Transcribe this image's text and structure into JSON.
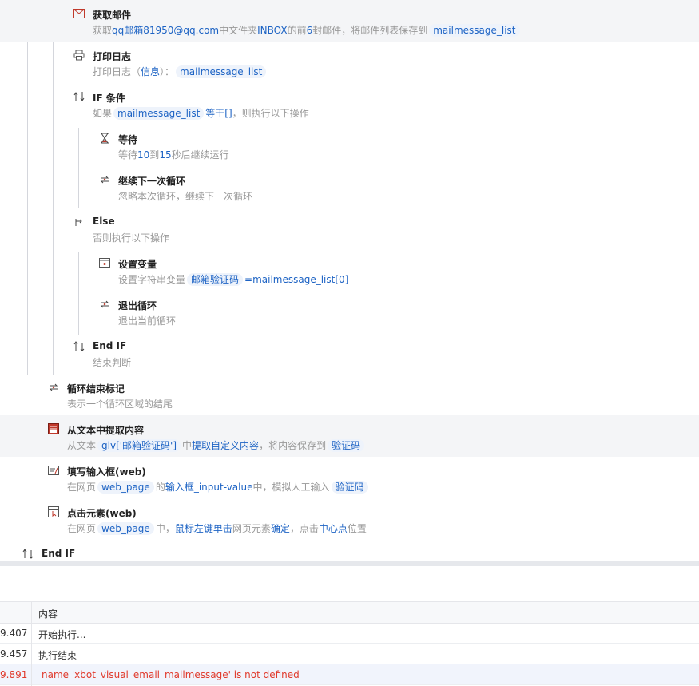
{
  "flow": {
    "steps": [
      {
        "title": "获取邮件",
        "desc": [
          [
            "t",
            "获取"
          ],
          [
            "k",
            "qq邮箱819"
          ],
          [
            "k",
            "50@qq.com"
          ],
          [
            "t",
            "中文件夹"
          ],
          [
            "k",
            "INBOX"
          ],
          [
            "t",
            "的前"
          ],
          [
            "k",
            "6"
          ],
          [
            "t",
            "封邮件，将邮件列表保存到"
          ],
          [
            "v",
            "mailmessage_list"
          ]
        ]
      },
      {
        "title": "打印日志",
        "desc": [
          [
            "t",
            "打印日志（"
          ],
          [
            "k",
            "信息"
          ],
          [
            "t",
            "）："
          ],
          [
            "v",
            "mailmessage_list"
          ]
        ]
      },
      {
        "title": "IF 条件",
        "desc": [
          [
            "t",
            "如果"
          ],
          [
            "v",
            "mailmessage_list"
          ],
          [
            "k",
            "等于[]"
          ],
          [
            "t",
            "，则执行以下操作"
          ]
        ]
      },
      {
        "title": "等待",
        "desc": [
          [
            "t",
            "等待"
          ],
          [
            "k",
            "10"
          ],
          [
            "t",
            "到"
          ],
          [
            "k",
            "15"
          ],
          [
            "t",
            "秒后继续运行"
          ]
        ]
      },
      {
        "title": "继续下一次循环",
        "desc": [
          [
            "t",
            "忽略本次循环，继续下一次循环"
          ]
        ]
      },
      {
        "title": "Else",
        "desc": [
          [
            "t",
            "否则执行以下操作"
          ]
        ]
      },
      {
        "title": "设置变量",
        "desc": [
          [
            "t",
            "设置字符串变量"
          ],
          [
            "v",
            "邮箱验证码"
          ],
          [
            "k",
            "=mailmessage_list[0]"
          ]
        ]
      },
      {
        "title": "退出循环",
        "desc": [
          [
            "t",
            "退出当前循环"
          ]
        ]
      },
      {
        "title": "End IF",
        "desc": [
          [
            "t",
            "结束判断"
          ]
        ]
      },
      {
        "title": "循环结束标记",
        "desc": [
          [
            "t",
            "表示一个循环区域的结尾"
          ]
        ]
      },
      {
        "title": "从文本中提取内容",
        "desc": [
          [
            "t",
            "从文本"
          ],
          [
            "v",
            "glv['邮箱验证码']"
          ],
          [
            "t",
            "中"
          ],
          [
            "k",
            "提取自定义内容"
          ],
          [
            "t",
            "，将内容保存到"
          ],
          [
            "v",
            "验证码"
          ]
        ]
      },
      {
        "title": "填写输入框(web)",
        "desc": [
          [
            "t",
            "在网页"
          ],
          [
            "v",
            "web_page"
          ],
          [
            "t",
            "的"
          ],
          [
            "k",
            "输入框_input-value"
          ],
          [
            "t",
            "中，模拟人工输入"
          ],
          [
            "v",
            "验证码"
          ]
        ]
      },
      {
        "title": "点击元素(web)",
        "desc": [
          [
            "t",
            "在网页"
          ],
          [
            "v",
            "web_page"
          ],
          [
            "t",
            "中，"
          ],
          [
            "k",
            "鼠标左键单击"
          ],
          [
            "t",
            "网页元素"
          ],
          [
            "k",
            "确定"
          ],
          [
            "t",
            "，点击"
          ],
          [
            "k",
            "中心点"
          ],
          [
            "t",
            "位置"
          ]
        ]
      },
      {
        "title": "End IF",
        "desc": []
      }
    ]
  },
  "log": {
    "header_content": "内容",
    "rows": [
      {
        "time": "9.407",
        "content": "开始执行..."
      },
      {
        "time": "9.457",
        "content": "执行结束"
      },
      {
        "time": "9.891",
        "content": "name 'xbot_visual_email_mailmessage' is not defined"
      }
    ]
  },
  "icons": [
    "mail-icon",
    "printer-icon",
    "if-icon",
    "hourglass-icon",
    "loop-continue-icon",
    "else-icon",
    "set-variable-icon",
    "loop-exit-icon",
    "end-if-icon",
    "loop-end-icon",
    "extract-text-icon",
    "fill-input-icon",
    "click-element-icon",
    "end-if-icon"
  ]
}
